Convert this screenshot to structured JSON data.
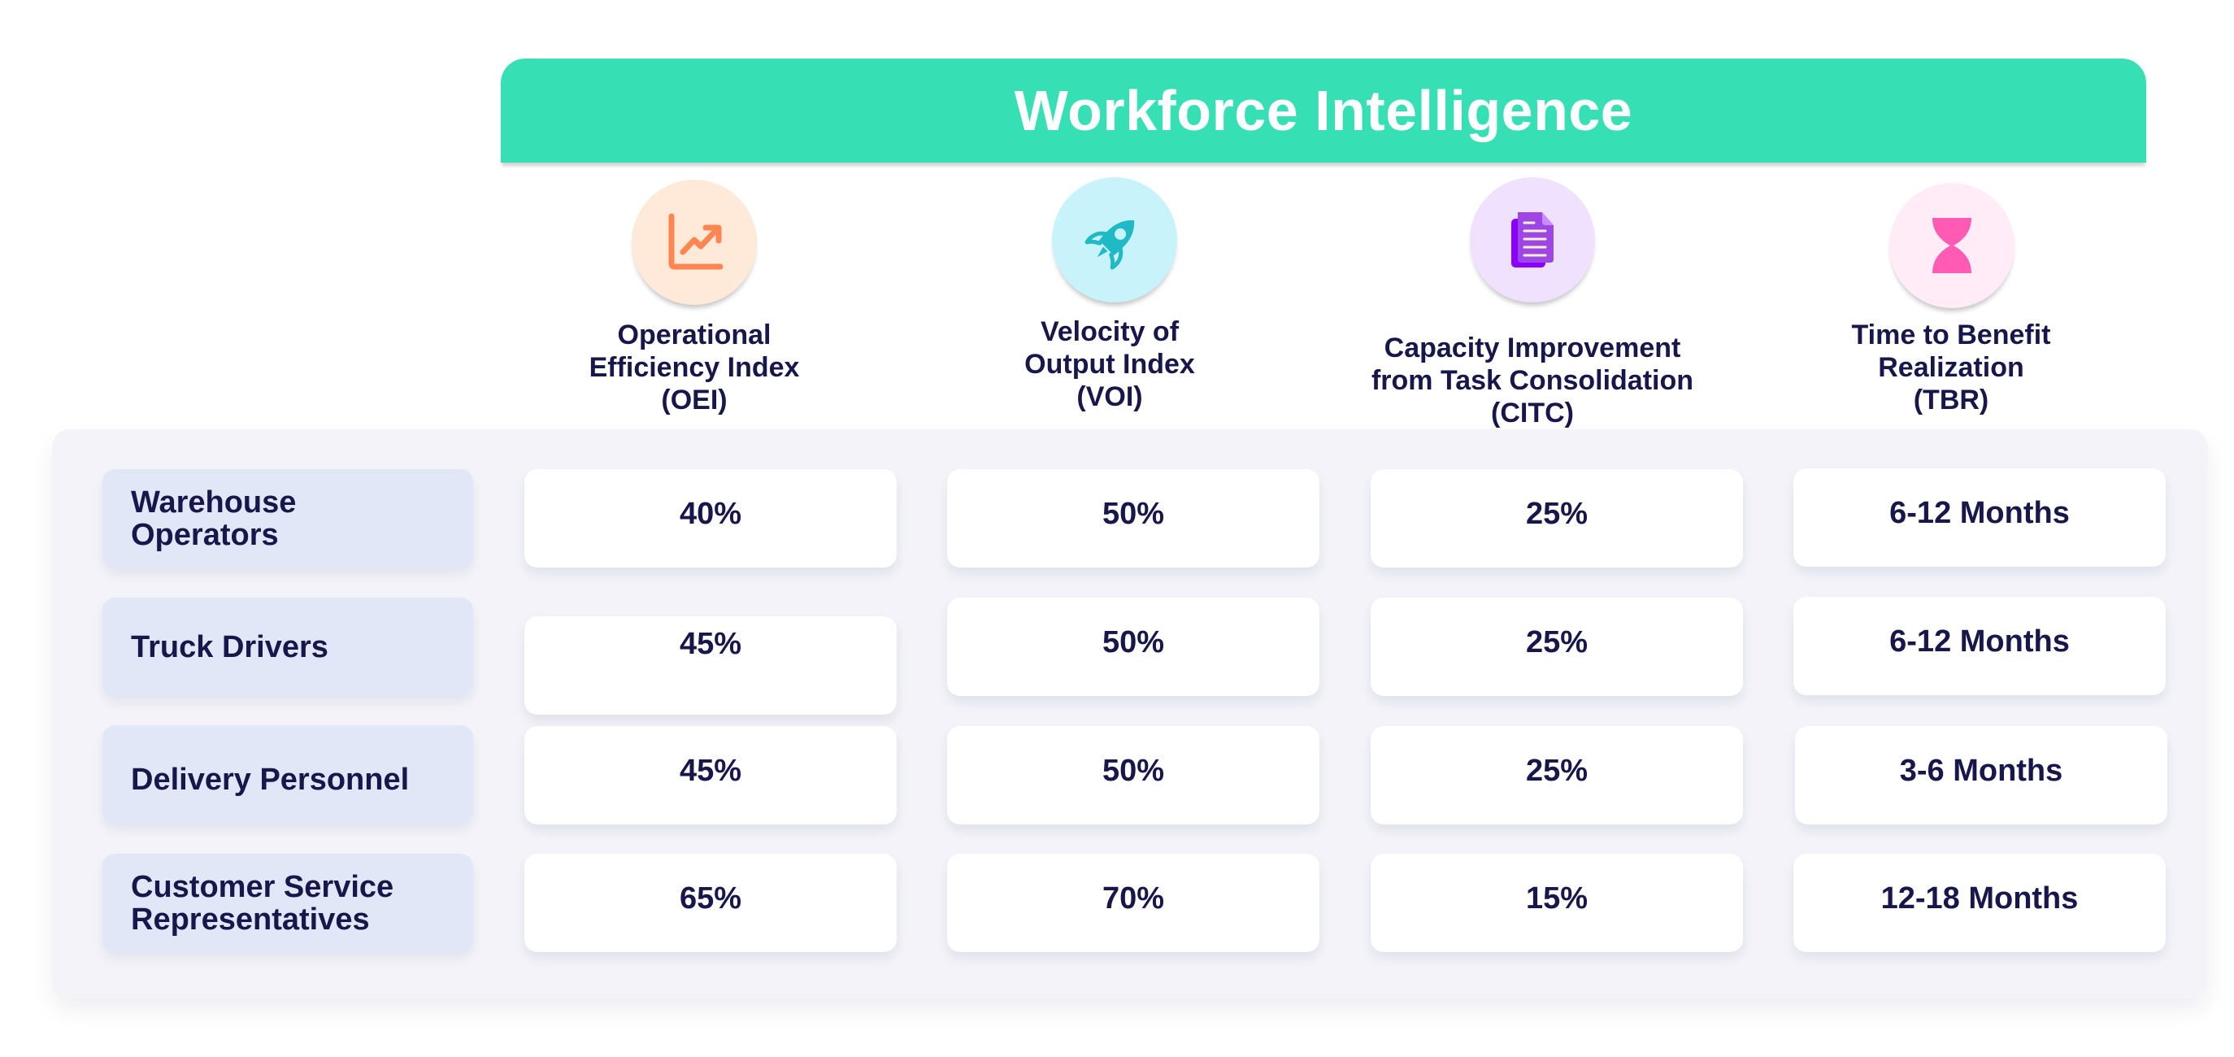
{
  "title": "Workforce Intelligence",
  "colors": {
    "title_bar": "#37e0b4",
    "text": "#17174b",
    "panel": "#f3f3f9",
    "row_label_bg": "#e1e7f7",
    "cell_bg": "#ffffff"
  },
  "columns": [
    {
      "label_lines": [
        "Operational",
        "Efficiency Index",
        "(OEI)"
      ],
      "icon": "trending-up-chart-icon",
      "icon_color": "#ff8551",
      "circle_color": "#ffe9d9"
    },
    {
      "label_lines": [
        "Velocity of",
        "Output Index",
        "(VOI)"
      ],
      "icon": "rocket-icon",
      "icon_color": "#20b9c6",
      "circle_color": "#c9f3fb"
    },
    {
      "label_lines": [
        "Capacity Improvement",
        "from Task Consolidation",
        "(CITC)"
      ],
      "icon": "document-icon",
      "icon_color": "#9b3fe0",
      "circle_color": "#f0e2fe"
    },
    {
      "label_lines": [
        "Time to Benefit",
        "Realization",
        "(TBR)"
      ],
      "icon": "hourglass-icon",
      "icon_color": "#ff5bb4",
      "circle_color": "#ffecf6"
    }
  ],
  "rows": [
    {
      "label_lines": [
        "Warehouse",
        "Operators"
      ],
      "values": [
        "40%",
        "50%",
        "25%",
        "6-12 Months"
      ]
    },
    {
      "label_lines": [
        "Truck Drivers"
      ],
      "values": [
        "45%",
        "50%",
        "25%",
        "6-12 Months"
      ]
    },
    {
      "label_lines": [
        "Delivery Personnel"
      ],
      "values": [
        "45%",
        "50%",
        "25%",
        "3-6 Months"
      ]
    },
    {
      "label_lines": [
        "Customer Service",
        "Representatives"
      ],
      "values": [
        "65%",
        "70%",
        "15%",
        "12-18 Months"
      ]
    }
  ]
}
